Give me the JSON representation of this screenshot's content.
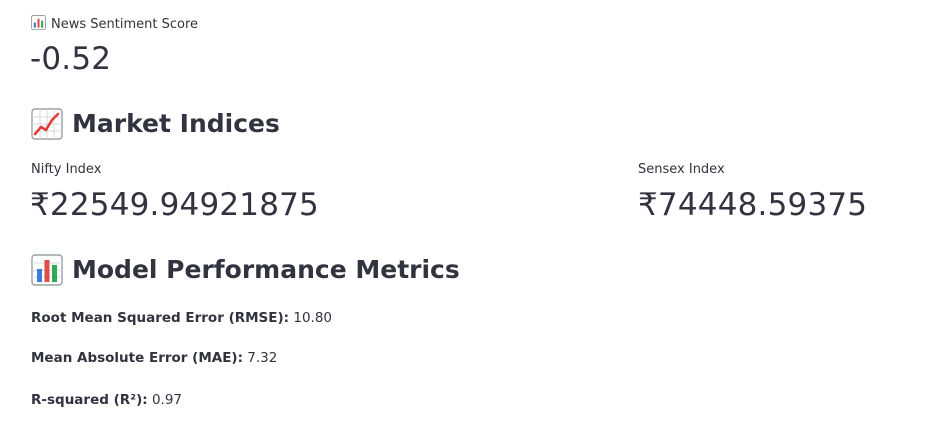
{
  "sentiment": {
    "icon": "bar-chart-icon",
    "label": "News Sentiment Score",
    "value": "-0.52"
  },
  "market_indices": {
    "heading_icon": "chart-increasing-icon",
    "heading": "Market Indices",
    "nifty": {
      "label": "Nifty Index",
      "value": "₹22549.94921875"
    },
    "sensex": {
      "label": "Sensex Index",
      "value": "₹74448.59375"
    }
  },
  "model_performance": {
    "heading_icon": "bar-chart-icon",
    "heading": "Model Performance Metrics",
    "rmse": {
      "label": "Root Mean Squared Error (RMSE):",
      "value": "10.80"
    },
    "mae": {
      "label": "Mean Absolute Error (MAE):",
      "value": "7.32"
    },
    "r2": {
      "label": "R-squared (R²):",
      "value": "0.97"
    }
  }
}
